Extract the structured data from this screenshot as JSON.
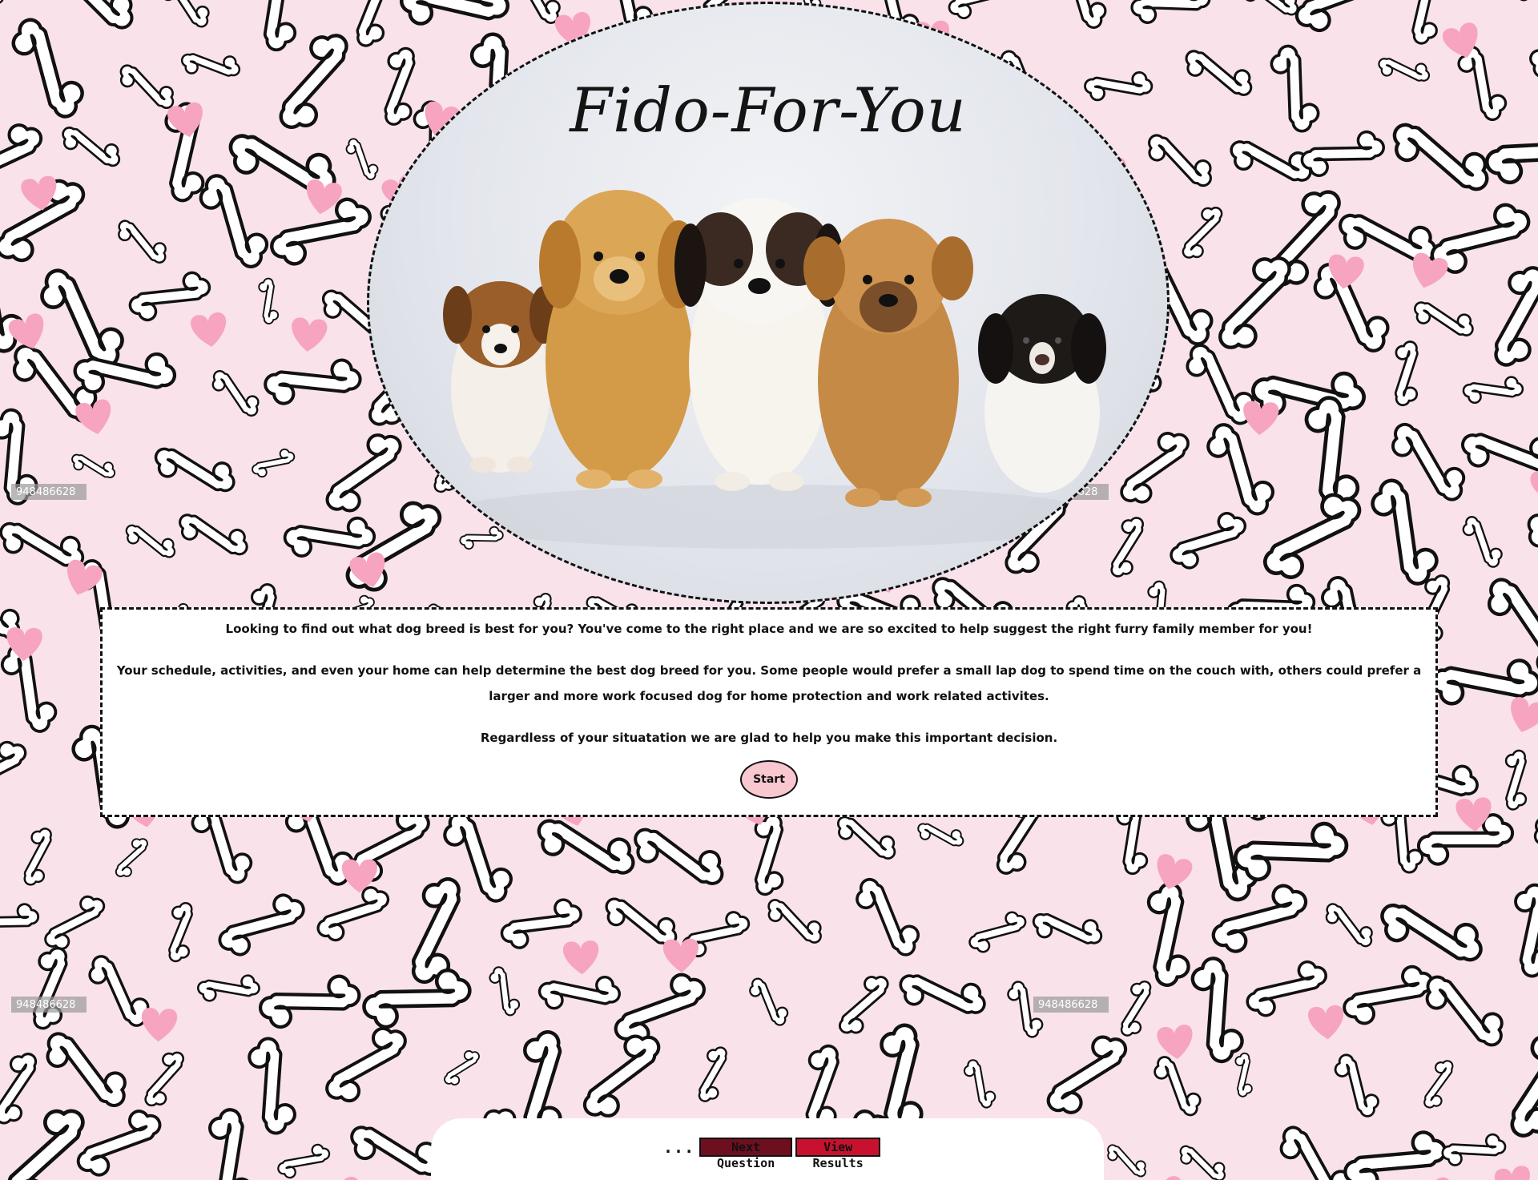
{
  "hero": {
    "title": "Fido-For-You"
  },
  "intro": {
    "paragraph_1": "Looking to find out what dog breed is best for you? You've come to the right place and we are so excited to help suggest the right furry family member for you!",
    "paragraph_2": "Your schedule, activities, and even your home can help determine the best dog breed for you. Some people would prefer a small lap dog to spend time on the couch with, others could prefer a larger and more work focused dog for home protection and work related activites.",
    "paragraph_3": "Regardless of your situatation we are glad to help you make this important decision.",
    "start_label": "Start"
  },
  "footer": {
    "ellipsis": "...",
    "next_label": "Next Question",
    "results_label": "View Results"
  },
  "background": {
    "watermark_id": "948486628"
  },
  "colors": {
    "page_background": "#f9e2ea",
    "heart": "#f7a4c0",
    "start_button": "#f8c7cf",
    "next_button": "#6e0f20",
    "results_button": "#c8112f"
  }
}
